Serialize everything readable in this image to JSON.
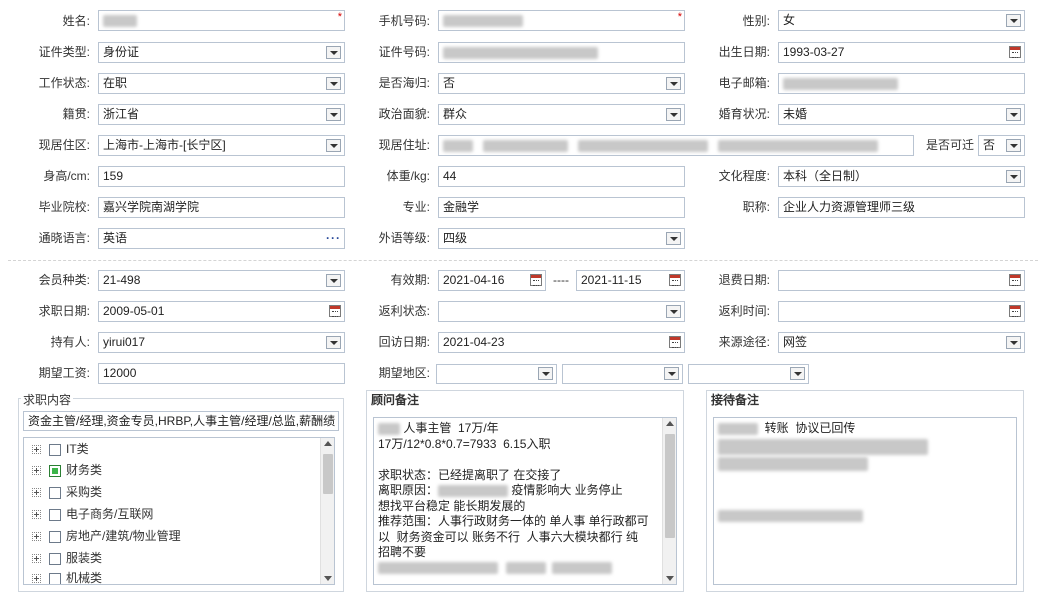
{
  "colors": {
    "required": "#d40000",
    "checked": "#3cb54a",
    "border": "#b9c4d2"
  },
  "basic": {
    "name": {
      "label": "姓名:"
    },
    "phone": {
      "label": "手机号码:"
    },
    "gender": {
      "label": "性别:",
      "value": "女"
    },
    "id_type": {
      "label": "证件类型:",
      "value": "身份证"
    },
    "id_no": {
      "label": "证件号码:"
    },
    "birth": {
      "label": "出生日期:",
      "value": "1993-03-27"
    },
    "work_status": {
      "label": "工作状态:",
      "value": "在职"
    },
    "returnee": {
      "label": "是否海归:",
      "value": "否"
    },
    "email": {
      "label": "电子邮箱:"
    },
    "native": {
      "label": "籍贯:",
      "value": "浙江省"
    },
    "politics": {
      "label": "政治面貌:",
      "value": "群众"
    },
    "marital": {
      "label": "婚育状况:",
      "value": "未婚"
    },
    "residence_area": {
      "label": "现居住区:",
      "value": "上海市-上海市-[长宁区]"
    },
    "residence_addr": {
      "label": "现居住址:"
    },
    "relocate": {
      "label": "是否可迁",
      "value": "否"
    },
    "height": {
      "label": "身高/cm:",
      "value": "159"
    },
    "weight": {
      "label": "体重/kg:",
      "value": "44"
    },
    "education": {
      "label": "文化程度:",
      "value": "本科（全日制）"
    },
    "school": {
      "label": "毕业院校:",
      "value": "嘉兴学院南湖学院"
    },
    "major": {
      "label": "专业:",
      "value": "金融学"
    },
    "title": {
      "label": "职称:",
      "value": "企业人力资源管理师三级"
    },
    "language": {
      "label": "通晓语言:",
      "value": "英语"
    },
    "lang_level": {
      "label": "外语等级:",
      "value": "四级"
    }
  },
  "member": {
    "type": {
      "label": "会员种类:",
      "value": "21-498"
    },
    "valid": {
      "label": "有效期:",
      "from": "2021-04-16",
      "sep": "----",
      "to": "2021-11-15"
    },
    "refund_date": {
      "label": "退费日期:"
    },
    "job_date": {
      "label": "求职日期:",
      "value": "2009-05-01"
    },
    "rebate_status": {
      "label": "返利状态:"
    },
    "rebate_time": {
      "label": "返利时间:"
    },
    "holder": {
      "label": "持有人:",
      "value": "yirui017"
    },
    "visit_date": {
      "label": "回访日期:",
      "value": "2021-04-23"
    },
    "source": {
      "label": "来源途径:",
      "value": "网签"
    },
    "salary": {
      "label": "期望工资:",
      "value": "12000"
    },
    "area": {
      "label": "期望地区:"
    }
  },
  "job_panel": {
    "title": "求职内容",
    "summary": "资金主管/经理,资金专员,HRBP,人事主管/经理/总监,薪酬绩",
    "tree": [
      {
        "label": "IT类",
        "checked": false
      },
      {
        "label": "财务类",
        "checked": true
      },
      {
        "label": "采购类",
        "checked": false
      },
      {
        "label": "电子商务/互联网",
        "checked": false
      },
      {
        "label": "房地产/建筑/物业管理",
        "checked": false
      },
      {
        "label": "服装类",
        "checked": false
      },
      {
        "label": "机械类",
        "checked": false
      }
    ]
  },
  "advisor_panel": {
    "title": "顾问备注",
    "lines": [
      " 人事主管  17万/年",
      "17万/12*0.8*0.7=7933  6.15入职",
      "",
      "求职状态：已经提离职了 在交接了",
      "离职原因：     疫情影响大 业务停止",
      "想找平台稳定 能长期发展的",
      "推荐范围：人事行政财务一体的 单人事 单行政都可",
      "以  财务资金可以 账务不行  人事六大模块都行 纯",
      "招聘不要"
    ]
  },
  "reception_panel": {
    "title": "接待备注",
    "lines": [
      "  转账  协议已回传"
    ]
  }
}
